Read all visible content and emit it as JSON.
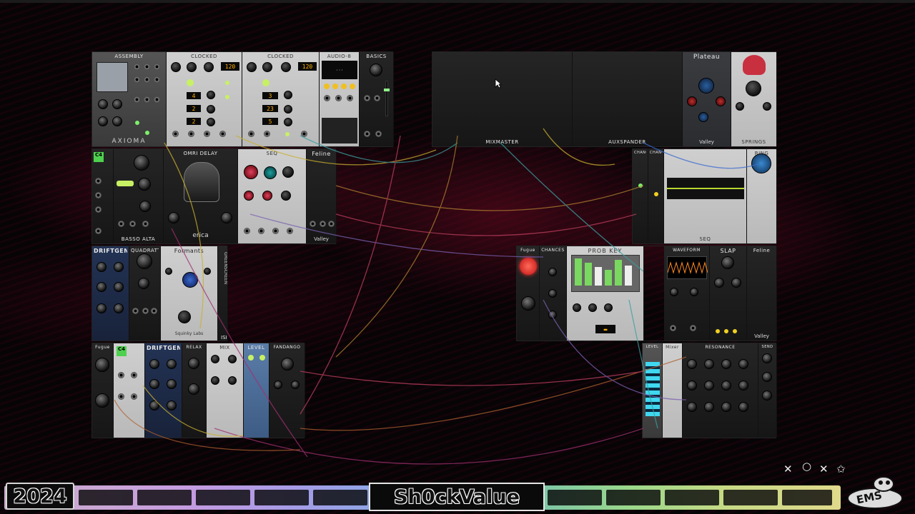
{
  "canvas": {
    "background": "#070406",
    "accent": "#8a0a2a"
  },
  "rack_top_left": {
    "modules": [
      {
        "label": "ASSEMBLY"
      },
      {
        "label": "CLOCKED"
      },
      {
        "label": "CLOCKED"
      },
      {
        "label": "AUDIO-8"
      },
      {
        "label": "BASICS"
      }
    ],
    "footer_axioma": "AXIOMA",
    "display_bpm_1": "120",
    "display_bpm_2": "120"
  },
  "rack_top_right": {
    "modules": [
      {
        "label": "MIXMASTER"
      },
      {
        "label": "AUXSPANDER"
      },
      {
        "label": "Plateau"
      },
      {
        "label": "SPRINGS"
      }
    ],
    "footer_valley": "Valley"
  },
  "rack_mid_left": {
    "modules": [
      {
        "label": "C4"
      },
      {
        "label": "BASSO ALTA"
      },
      {
        "label": "OMRI DELAY"
      },
      {
        "label": "erica"
      },
      {
        "label": "SEQ"
      },
      {
        "label": "Feline"
      }
    ],
    "footer_valley": "Valley"
  },
  "rack_mid_right": {
    "modules": [
      {
        "label": "CHANCES"
      },
      {
        "label": "CHANCES"
      },
      {
        "label": "SEQ"
      },
      {
        "label": "RING"
      }
    ]
  },
  "rack_row3_left": {
    "modules": [
      {
        "label": "DRIFTGEN"
      },
      {
        "label": "QUADRATT"
      },
      {
        "label": "Formants"
      },
      {
        "label": "GREENSCREEN"
      }
    ],
    "footer_sub": "Squinky Labs",
    "tag_isi": "ISI"
  },
  "rack_row3_right": {
    "modules": [
      {
        "label": "Fugue"
      },
      {
        "label": "CHANCES"
      },
      {
        "label": "PROB KEY"
      },
      {
        "label": "WAVEFORM"
      },
      {
        "label": "SLAP"
      },
      {
        "label": "Feline"
      }
    ],
    "footer_valley": "Valley"
  },
  "rack_bottom_left": {
    "modules": [
      {
        "label": "Fugue"
      },
      {
        "label": "C4"
      },
      {
        "label": "DRIFTGEN"
      },
      {
        "label": "RELAX"
      },
      {
        "label": "MIX"
      },
      {
        "label": "LEVEL"
      },
      {
        "label": "FANDANGO"
      }
    ]
  },
  "rack_bottom_right": {
    "modules": [
      {
        "label": "LEVEL"
      },
      {
        "label": "Mixer"
      },
      {
        "label": "RESONANCE"
      },
      {
        "label": "SEND"
      }
    ]
  },
  "overlay": {
    "year": "2024",
    "title": "Sh0ckValue",
    "logo": "EMS",
    "deco_symbols": [
      "✕",
      "○",
      "✕",
      "✩"
    ]
  }
}
